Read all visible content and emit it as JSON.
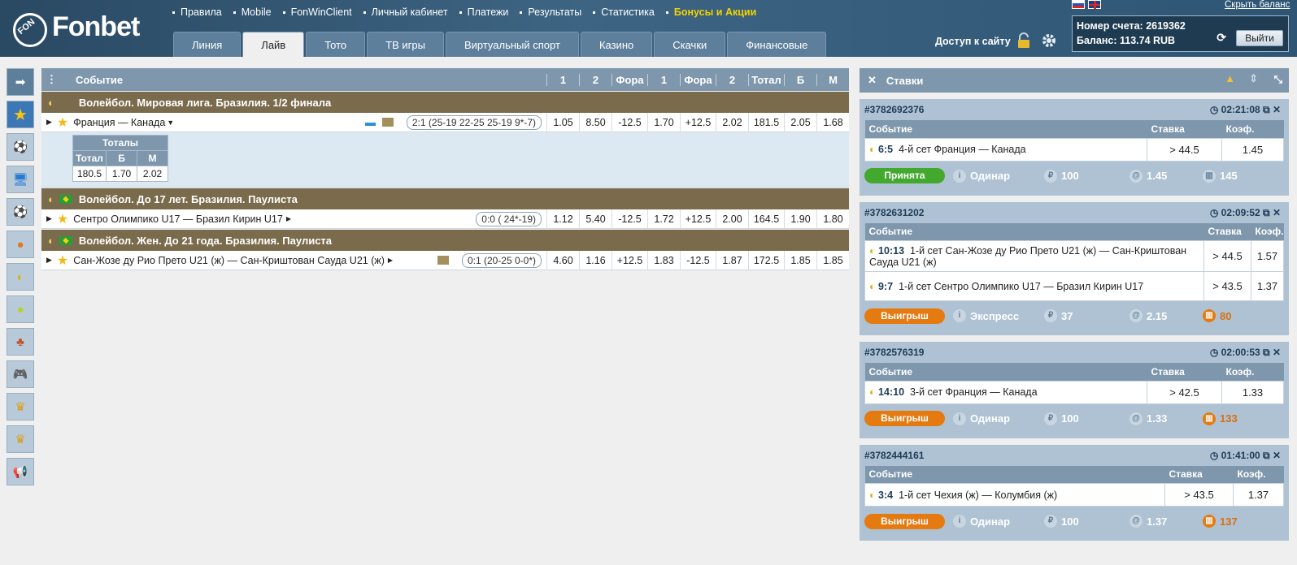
{
  "brand": {
    "logo_small": "FON",
    "name": "Fonbet"
  },
  "topnav": [
    "Правила",
    "Mobile",
    "FonWinClient",
    "Личный кабинет",
    "Платежи",
    "Результаты",
    "Статистика"
  ],
  "topnav_bonus": "Бонусы и Акции",
  "tabs": [
    "Линия",
    "Лайв",
    "Тото",
    "ТВ игры",
    "Виртуальный спорт",
    "Казино",
    "Скачки",
    "Финансовые"
  ],
  "active_tab": "Лайв",
  "access_label": "Доступ к сайту",
  "account": {
    "number_label": "Номер счета:",
    "number": "2619362",
    "balance_label": "Баланс:",
    "balance": "113.74 RUB",
    "logout": "Выйти",
    "hide_balance": "Скрыть баланс"
  },
  "events": {
    "headers": [
      "Событие",
      "1",
      "2",
      "Фора",
      "1",
      "Фора",
      "2",
      "Тотал",
      "Б",
      "М"
    ],
    "groups": [
      {
        "title": "Волейбол. Мировая лига. Бразилия. 1/2 финала",
        "row": {
          "name": "Франция — Канада",
          "score": "2:1 (25-19 22-25 25-19 9*-7)",
          "odds": [
            "1.05",
            "8.50",
            "-12.5",
            "1.70",
            "+12.5",
            "2.02",
            "181.5",
            "2.05",
            "1.68"
          ]
        },
        "totals": {
          "title": "Тоталы",
          "headers": [
            "Тотал",
            "Б",
            "М"
          ],
          "values": [
            "180.5",
            "1.70",
            "2.02"
          ]
        }
      },
      {
        "title": "Волейбол. До 17 лет. Бразилия. Паулиста",
        "row": {
          "name": "Сентро Олимпико U17 — Бразил Кирин U17",
          "score": "0:0 ( 24*-19)",
          "odds": [
            "1.12",
            "5.40",
            "-12.5",
            "1.72",
            "+12.5",
            "2.00",
            "164.5",
            "1.90",
            "1.80"
          ]
        }
      },
      {
        "title": "Волейбол. Жен. До 21 года. Бразилия. Паулиста",
        "row": {
          "name": "Сан-Жозе ду Рио Прето U21 (ж) — Сан-Криштован Сауда U21 (ж)",
          "score": "0:1 (20-25 0-0*)",
          "odds": [
            "4.60",
            "1.16",
            "+12.5",
            "1.83",
            "-12.5",
            "1.87",
            "172.5",
            "1.85",
            "1.85"
          ]
        }
      }
    ]
  },
  "bets_panel": {
    "title": "Ставки",
    "col_event": "Событие",
    "col_stake": "Ставка",
    "col_coef": "Коэф.",
    "bets": [
      {
        "id": "#3782692376",
        "time": "02:21:08",
        "lines": [
          {
            "score": "6:5",
            "desc": "4-й сет Франция — Канада",
            "stake": "> 44.5",
            "coef": "1.45"
          }
        ],
        "status": "Принята",
        "type": "Одинар",
        "amount": "100",
        "at": "1.45",
        "payout": "145"
      },
      {
        "id": "#3782631202",
        "time": "02:09:52",
        "lines": [
          {
            "score": "10:13",
            "desc": "1-й сет Сан-Жозе ду Рио Прето U21 (ж) — Сан-Криштован Сауда U21 (ж)",
            "stake": "> 44.5",
            "coef": "1.57"
          },
          {
            "score": "9:7",
            "desc": "1-й сет Сентро Олимпико U17 — Бразил Кирин U17",
            "stake": "> 43.5",
            "coef": "1.37"
          }
        ],
        "status": "Выигрыш",
        "type": "Экспресс",
        "amount": "37",
        "at": "2.15",
        "payout": "80"
      },
      {
        "id": "#3782576319",
        "time": "02:00:53",
        "lines": [
          {
            "score": "14:10",
            "desc": "3-й сет Франция — Канада",
            "stake": "> 42.5",
            "coef": "1.33"
          }
        ],
        "status": "Выигрыш",
        "type": "Одинар",
        "amount": "100",
        "at": "1.33",
        "payout": "133"
      },
      {
        "id": "#3782444161",
        "time": "01:41:00",
        "lines": [
          {
            "score": "3:4",
            "desc": "1-й сет Чехия (ж) — Колумбия (ж)",
            "stake": "> 43.5",
            "coef": "1.37"
          }
        ],
        "status": "Выигрыш",
        "type": "Одинар",
        "amount": "100",
        "at": "1.37",
        "payout": "137"
      }
    ]
  },
  "colors": {
    "header": "#2a4963",
    "competition": "#7a6b4c",
    "table_head": "#7e97ad",
    "accepted": "#43a92e",
    "win": "#e47a10",
    "bonus": "#f4d200"
  }
}
